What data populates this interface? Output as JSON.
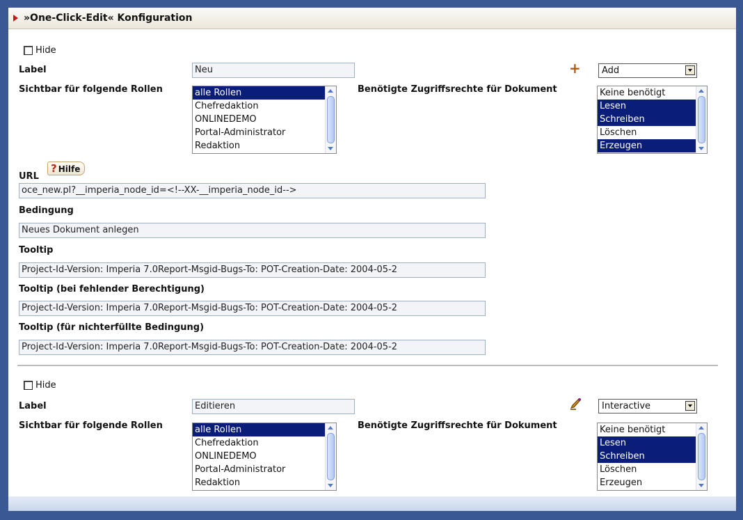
{
  "title": "»One-Click-Edit« Konfiguration",
  "blocks": [
    {
      "hide_label": "Hide",
      "label_caption": "Label",
      "label_value": "Neu",
      "type_select": "Add",
      "roles_caption": "Sichtbar für folgende Rollen",
      "roles": [
        {
          "name": "alle Rollen",
          "selected": true
        },
        {
          "name": "Chefredaktion",
          "selected": false
        },
        {
          "name": "ONLINEDEMO",
          "selected": false
        },
        {
          "name": "Portal-Administrator",
          "selected": false
        },
        {
          "name": "Redaktion",
          "selected": false
        }
      ],
      "rights_caption": "Benötigte Zugriffsrechte für Dokument",
      "rights": [
        {
          "name": "Keine benötigt",
          "selected": false
        },
        {
          "name": "Lesen",
          "selected": true
        },
        {
          "name": "Schreiben",
          "selected": true
        },
        {
          "name": "Löschen",
          "selected": false
        },
        {
          "name": "Erzeugen",
          "selected": true
        }
      ],
      "url_caption": "URL",
      "help_label": "Hilfe",
      "url_value": "oce_new.pl?__imperia_node_id=<!--XX-__imperia_node_id-->",
      "condition_caption": "Bedingung",
      "condition_value": "Neues Dokument anlegen",
      "tooltip_caption": "Tooltip",
      "tooltip_value": "Project-Id-Version: Imperia 7.0Report-Msgid-Bugs-To: POT-Creation-Date: 2004-05-2",
      "tooltip_noperm_caption": "Tooltip (bei fehlender Berechtigung)",
      "tooltip_noperm_value": "Project-Id-Version: Imperia 7.0Report-Msgid-Bugs-To: POT-Creation-Date: 2004-05-2",
      "tooltip_nocond_caption": "Tooltip (für nichterfüllte Bedingung)",
      "tooltip_nocond_value": "Project-Id-Version: Imperia 7.0Report-Msgid-Bugs-To: POT-Creation-Date: 2004-05-2"
    },
    {
      "hide_label": "Hide",
      "label_caption": "Label",
      "label_value": "Editieren",
      "type_select": "Interactive",
      "roles_caption": "Sichtbar für folgende Rollen",
      "roles": [
        {
          "name": "alle Rollen",
          "selected": true
        },
        {
          "name": "Chefredaktion",
          "selected": false
        },
        {
          "name": "ONLINEDEMO",
          "selected": false
        },
        {
          "name": "Portal-Administrator",
          "selected": false
        },
        {
          "name": "Redaktion",
          "selected": false
        }
      ],
      "rights_caption": "Benötigte Zugriffsrechte für Dokument",
      "rights": [
        {
          "name": "Keine benötigt",
          "selected": false
        },
        {
          "name": "Lesen",
          "selected": true
        },
        {
          "name": "Schreiben",
          "selected": true
        },
        {
          "name": "Löschen",
          "selected": false
        },
        {
          "name": "Erzeugen",
          "selected": false
        }
      ]
    }
  ]
}
